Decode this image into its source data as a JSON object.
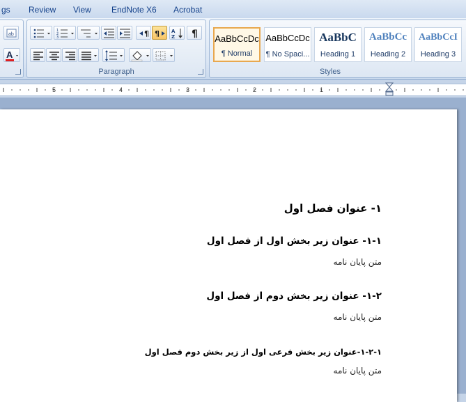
{
  "tabs": [
    "gs",
    "Review",
    "View",
    "EndNote X6",
    "Acrobat"
  ],
  "groups": {
    "paragraph_label": "Paragraph",
    "styles_label": "Styles"
  },
  "styles": [
    {
      "sample": "AaBbCcDc",
      "name": "¶ Normal",
      "selected": true
    },
    {
      "sample": "AaBbCcDc",
      "name": "¶ No Spaci...",
      "selected": false
    },
    {
      "sample": "AaBbC",
      "name": "Heading 1",
      "selected": false
    },
    {
      "sample": "AaBbCc",
      "name": "Heading 2",
      "selected": false
    },
    {
      "sample": "AaBbCcI",
      "name": "Heading 3",
      "selected": false
    }
  ],
  "ruler": {
    "numbers": [
      "5",
      "4",
      "3",
      "2",
      "1"
    ]
  },
  "document": {
    "h1": "۱- عنوان فصل اول",
    "h2a": "۱-۱- عنوان زیر بخش اول از فصل اول",
    "body1": "متن پایان نامه",
    "h2b": "۱-۲- عنوان زیر بخش دوم از فصل اول",
    "body2": "متن پایان نامه",
    "h3": "۱-۲-۱-عنوان زیر بخش فرعی اول از زیر بخش دوم فصل اول",
    "body3": "متن پایان نامه"
  },
  "colors": {
    "ribbon_text": "#15428b",
    "selected_style": "#e8a84f",
    "doc_background": "#9ab0cf"
  }
}
